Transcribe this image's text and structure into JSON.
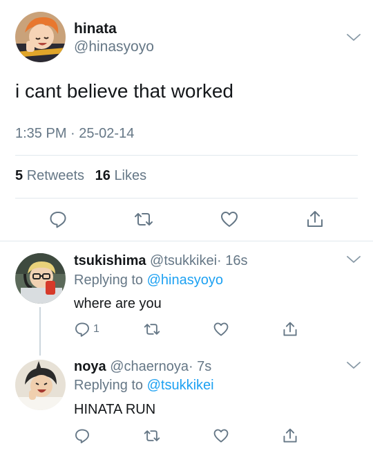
{
  "main_tweet": {
    "author_name": "hinata",
    "author_handle": "@hinasyoyo",
    "text": "i cant believe that worked",
    "timestamp": "1:35 PM · 25-02-14",
    "retweets_count": "5",
    "retweets_label": "Retweets",
    "likes_count": "16",
    "likes_label": "Likes",
    "avatar_icon": "hinata-avatar"
  },
  "replies": [
    {
      "author_name": "tsukishima",
      "author_handle": "@tsukkikei",
      "time_ago": "· 16s",
      "replying_prefix": "Replying to",
      "replying_to": "@hinasyoyo",
      "text": "where are you",
      "reply_count": "1",
      "avatar_icon": "tsukishima-avatar"
    },
    {
      "author_name": "noya",
      "author_handle": "@chaernoya",
      "time_ago": "· 7s",
      "replying_prefix": "Replying to",
      "replying_to": "@tsukkikei",
      "text": "HINATA RUN",
      "reply_count": "",
      "avatar_icon": "noya-avatar"
    }
  ],
  "icons": [
    "reply-icon",
    "retweet-icon",
    "like-icon",
    "share-icon",
    "chevron-down-icon"
  ],
  "colors": {
    "text": "#14171a",
    "muted": "#657786",
    "link": "#1da1f2",
    "divider": "#e1e8ed"
  }
}
